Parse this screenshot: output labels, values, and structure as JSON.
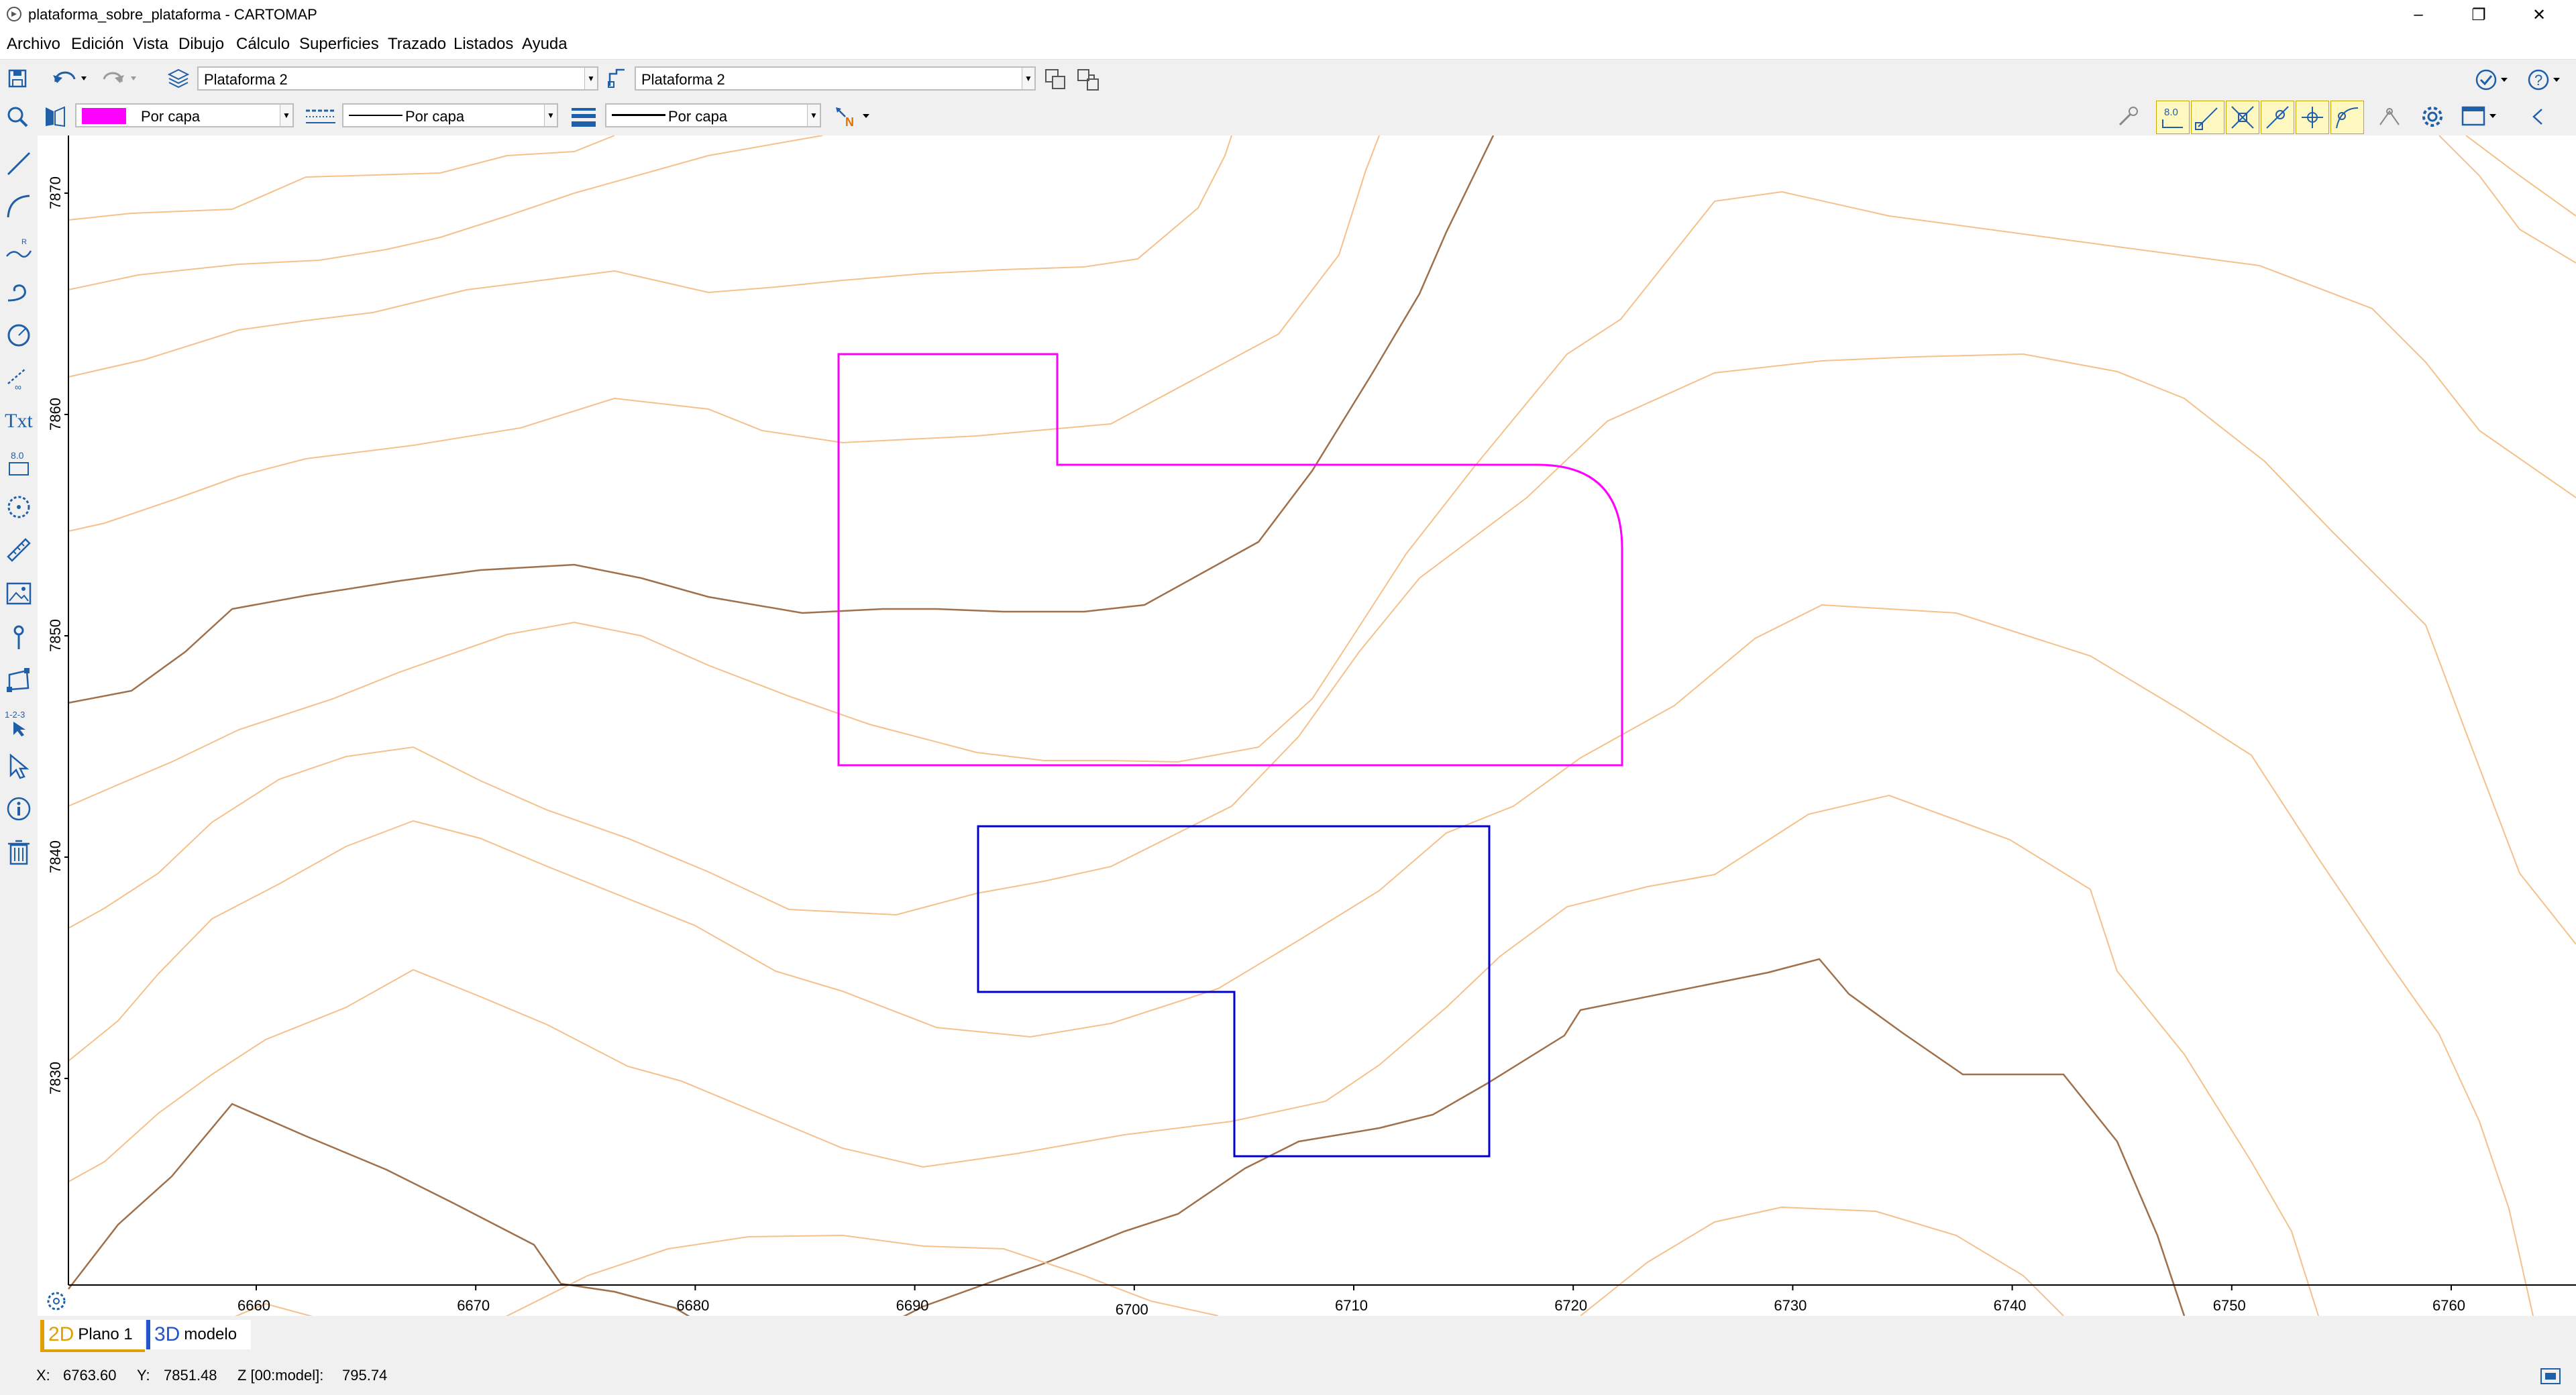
{
  "window": {
    "title": "plataforma_sobre_plataforma - CARTOMAP",
    "controls": [
      "–",
      "❐",
      "✕"
    ]
  },
  "menu": [
    "Archivo",
    "Edición",
    "Vista",
    "Dibujo",
    "Cálculo",
    "Superficies",
    "Trazado",
    "Listados",
    "Ayuda"
  ],
  "toolbar1": {
    "layer_combo": "Plataforma 2",
    "platform_combo": "Plataforma 2"
  },
  "toolbar2": {
    "color_value": "Por capa",
    "color_swatch": "#ff00ff",
    "linetype_value": "Por capa",
    "lineweight_value": "Por capa",
    "north_label": "N",
    "text_height_label": "8.0"
  },
  "left_tools": {
    "text_tool_label": "Txt",
    "height_tool_label": "8.0",
    "numbering_tool_label": "1-2-3"
  },
  "axes": {
    "x_ticks": [
      "6660",
      "6670",
      "6680",
      "6690",
      "6700",
      "6710",
      "6720",
      "6730",
      "6740",
      "6750",
      "6760"
    ],
    "y_ticks": [
      "7870",
      "7860",
      "7850",
      "7840",
      "7830"
    ]
  },
  "tabs": [
    {
      "key": "2D",
      "label": "Plano 1",
      "accent": "#e0a000"
    },
    {
      "key": "3D",
      "label": "modelo",
      "accent": "#2255cc"
    }
  ],
  "status": {
    "x_label": "X:",
    "x_value": "6763.60",
    "y_label": "Y:",
    "y_value": "7851.48",
    "z_label": "Z [00:model]:",
    "z_value": "795.74"
  },
  "colors": {
    "platform_1": "#ff00ff",
    "platform_2": "#0000cc",
    "contour_major": "#a0704a",
    "contour_minor": "#f5c08a"
  }
}
